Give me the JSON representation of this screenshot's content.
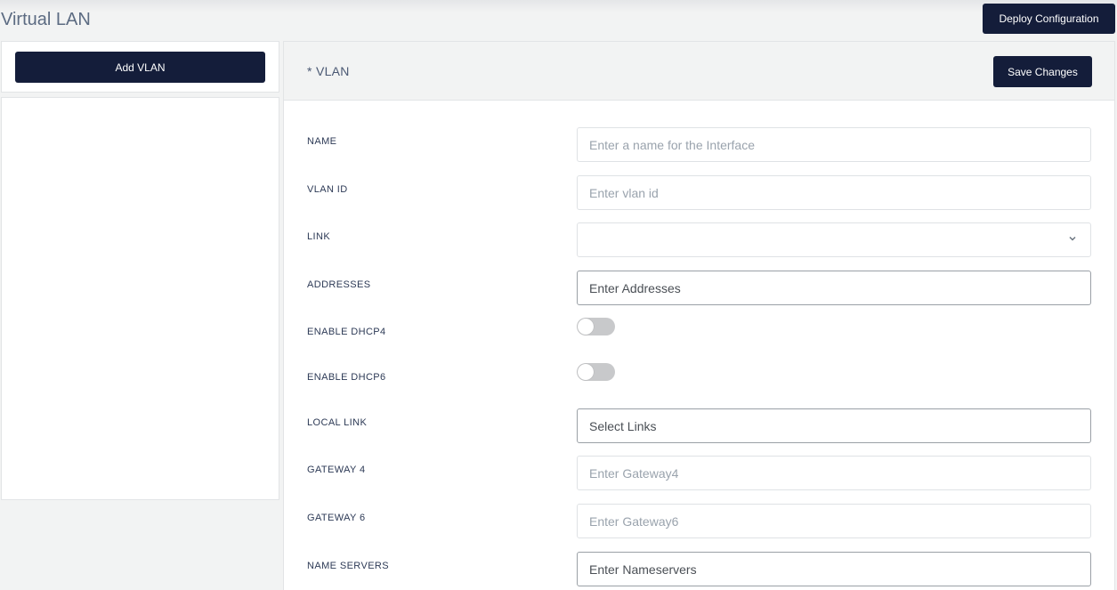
{
  "header": {
    "title": "Virtual LAN",
    "deploy_label": "Deploy Configuration"
  },
  "sidebar": {
    "add_label": "Add VLAN",
    "items": []
  },
  "panel": {
    "title": "* VLAN",
    "save_label": "Save Changes"
  },
  "form": {
    "name": {
      "label": "NAME",
      "placeholder": "Enter a name for the Interface",
      "value": ""
    },
    "vlan_id": {
      "label": "VLAN ID",
      "placeholder": "Enter vlan id",
      "value": ""
    },
    "link": {
      "label": "LINK",
      "selected": ""
    },
    "addresses": {
      "label": "ADDRESSES",
      "placeholder": "Enter Addresses",
      "value": ""
    },
    "dhcp4": {
      "label": "ENABLE DHCP4",
      "enabled": false
    },
    "dhcp6": {
      "label": "ENABLE DHCP6",
      "enabled": false
    },
    "local_link": {
      "label": "LOCAL LINK",
      "placeholder": "Select Links",
      "value": ""
    },
    "gateway4": {
      "label": "GATEWAY 4",
      "placeholder": "Enter Gateway4",
      "value": ""
    },
    "gateway6": {
      "label": "GATEWAY 6",
      "placeholder": "Enter Gateway6",
      "value": ""
    },
    "nameservers": {
      "label": "NAME SERVERS",
      "placeholder": "Enter Nameservers",
      "value": ""
    }
  },
  "icons": {
    "link_select": "chevron-down-icon"
  },
  "colors": {
    "primary_button": "#141d3a",
    "toggle_off": "#c8c9cb"
  }
}
